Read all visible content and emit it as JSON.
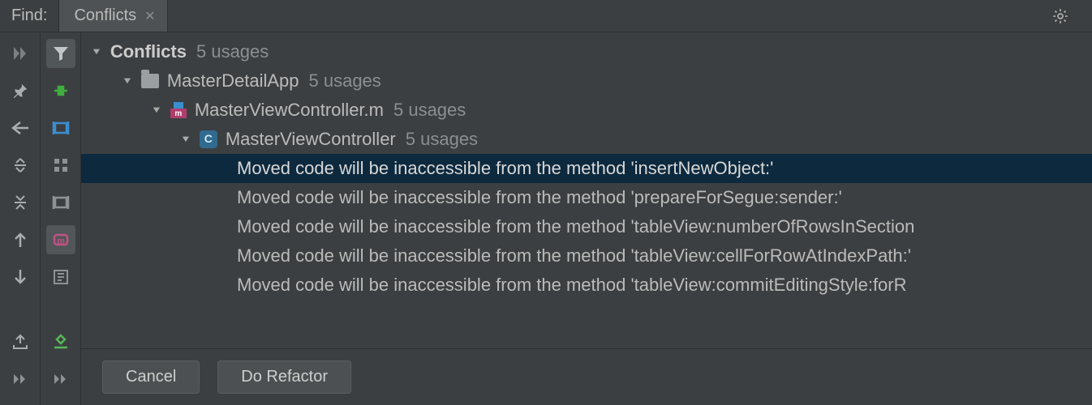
{
  "header": {
    "find_label": "Find:",
    "tab_title": "Conflicts"
  },
  "tree": {
    "root": {
      "label": "Conflicts",
      "usages": "5 usages"
    },
    "project": {
      "label": "MasterDetailApp",
      "usages": "5 usages"
    },
    "file": {
      "label": "MasterViewController.m",
      "usages": "5 usages"
    },
    "class": {
      "label": "MasterViewController",
      "usages": "5 usages"
    },
    "results": [
      "Moved code will be inaccessible from the method 'insertNewObject:'",
      "Moved code will be inaccessible from the method 'prepareForSegue:sender:'",
      "Moved code will be inaccessible from the method 'tableView:numberOfRowsInSection",
      "Moved code will be inaccessible from the method 'tableView:cellForRowAtIndexPath:'",
      "Moved code will be inaccessible from the method 'tableView:commitEditingStyle:forR"
    ]
  },
  "footer": {
    "cancel": "Cancel",
    "do_refactor": "Do Refactor"
  },
  "colors": {
    "background": "#3c3f41",
    "selection": "#0d293e",
    "border": "#2d2f30",
    "text": "#bbbbbb",
    "text_muted": "#8a8f91"
  }
}
